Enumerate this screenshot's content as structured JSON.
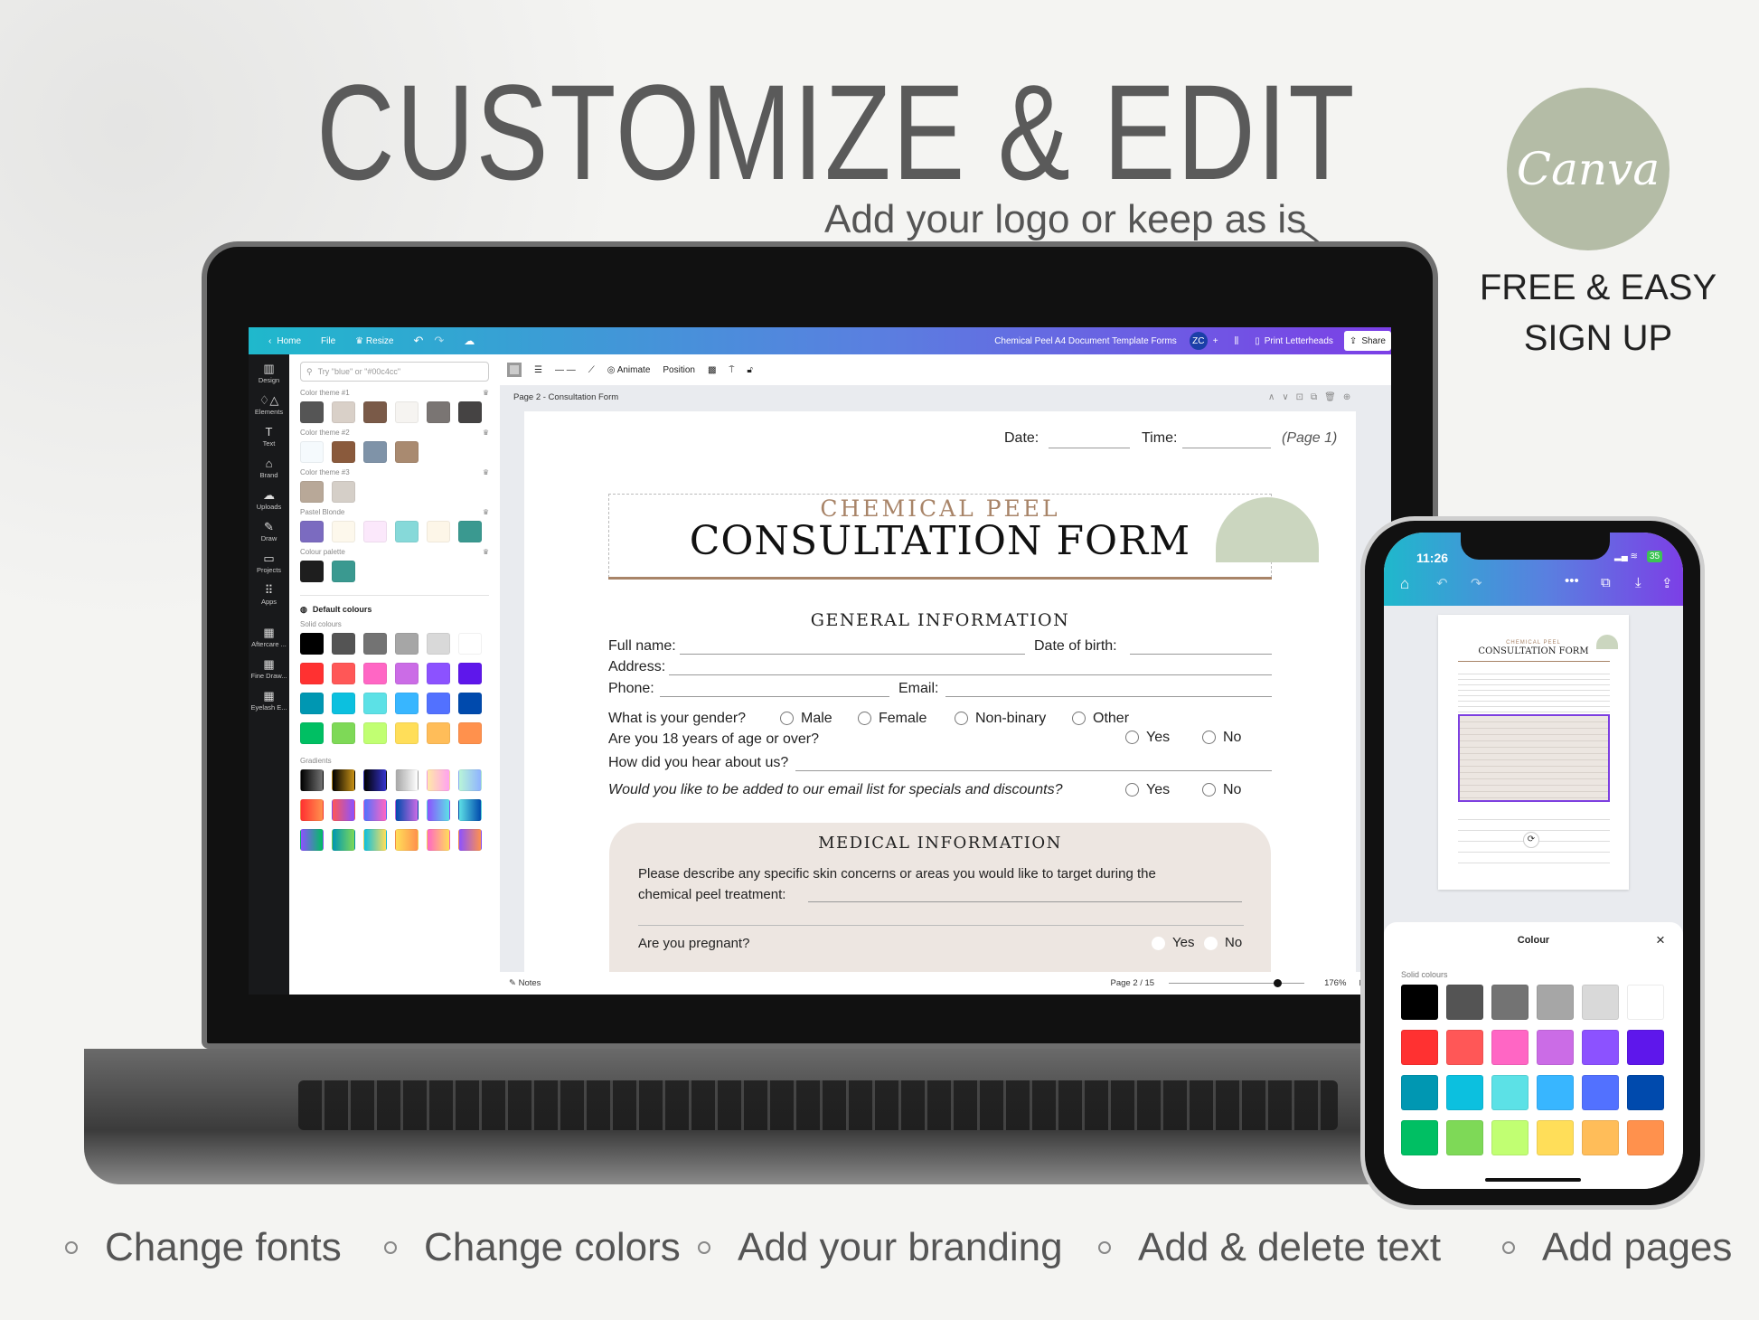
{
  "headline": "CUSTOMIZE & EDIT",
  "subline": "Add your logo or keep as is",
  "brand": {
    "logo_text": "Canva",
    "line1": "FREE & EASY",
    "line2": "SIGN UP",
    "circle_color": "#b4bca6"
  },
  "features": [
    "Change fonts",
    "Change colors",
    "Add your branding",
    "Add & delete text",
    "Add pages"
  ],
  "editor": {
    "topbar": {
      "back_icon": "chevron-left-icon",
      "home": "Home",
      "file": "File",
      "resize": "Resize",
      "doc_title": "Chemical Peel A4 Document Template Forms",
      "avatar": "ZC",
      "print": "Print Letterheads",
      "share": "Share"
    },
    "rail": [
      {
        "label": "Design",
        "icon": "▥"
      },
      {
        "label": "Elements",
        "icon": "♢△"
      },
      {
        "label": "Text",
        "icon": "T"
      },
      {
        "label": "Brand",
        "icon": "⌂"
      },
      {
        "label": "Uploads",
        "icon": "☁"
      },
      {
        "label": "Draw",
        "icon": "✎"
      },
      {
        "label": "Projects",
        "icon": "▭"
      },
      {
        "label": "Apps",
        "icon": "⠿"
      },
      {
        "label": "Aftercare ...",
        "icon": "▦"
      },
      {
        "label": "Fine Draw...",
        "icon": "▦"
      },
      {
        "label": "Eyelash E...",
        "icon": "▦"
      }
    ],
    "panel": {
      "search_placeholder": "Try \"blue\" or \"#00c4cc\"",
      "themes": [
        {
          "title": "Color theme #1",
          "colors": [
            "#555555",
            "#d9d0c8",
            "#7a5a48",
            "#f6f4f1",
            "#7a7573",
            "#454343"
          ]
        },
        {
          "title": "Color theme #2",
          "colors": [
            "#f5fafd",
            "#8a5a3c",
            "#7f93a8",
            "#a98a70"
          ]
        },
        {
          "title": "Color theme #3",
          "colors": [
            "#b8a898",
            "#d5cfc8"
          ]
        },
        {
          "title": "Pastel Blonde",
          "colors": [
            "#7b6bc0",
            "#fdf8ec",
            "#fbe8fb",
            "#86d9d9",
            "#fdf6e8",
            "#3a9990"
          ]
        },
        {
          "title": "Colour palette",
          "colors": [
            "#1e1e1e",
            "#3a9990"
          ]
        }
      ],
      "default_title": "Default colours",
      "solid_title": "Solid colours",
      "solid": [
        "#000000",
        "#545454",
        "#737373",
        "#a6a6a6",
        "#d9d9d9",
        "#ffffff",
        "#ff3131",
        "#ff5757",
        "#ff66c4",
        "#cb6ce6",
        "#8c52ff",
        "#5e17eb",
        "#0097b2",
        "#0cc0df",
        "#5ce1e6",
        "#38b6ff",
        "#5271ff",
        "#004aad",
        "#00bf63",
        "#7ed957",
        "#c1ff72",
        "#ffde59",
        "#ffbd59",
        "#ff914d"
      ],
      "gradients_title": "Gradients",
      "gradients": [
        [
          "#000000",
          "#737373"
        ],
        [
          "#000000",
          "#c89116"
        ],
        [
          "#000000",
          "#3533cd"
        ],
        [
          "#a6a6a6",
          "#ffffff"
        ],
        [
          "#ffe8a8",
          "#ffa2f0"
        ],
        [
          "#b8f5d8",
          "#8fb3ff"
        ],
        [
          "#ff3131",
          "#ff914d"
        ],
        [
          "#ff5757",
          "#8c52ff"
        ],
        [
          "#5170ff",
          "#ff66c4"
        ],
        [
          "#004aad",
          "#cb6ce6"
        ],
        [
          "#8c52ff",
          "#5ce1e6"
        ],
        [
          "#5de0e6",
          "#004aad"
        ],
        [
          "#8c52ff",
          "#00bf63"
        ],
        [
          "#0097b2",
          "#7ed957"
        ],
        [
          "#0cc0df",
          "#ffde59"
        ],
        [
          "#ffde59",
          "#ff914d"
        ],
        [
          "#ff66c4",
          "#ffde59"
        ],
        [
          "#8c52ff",
          "#ff914d"
        ]
      ]
    },
    "toolbar": {
      "animate": "Animate",
      "position": "Position"
    },
    "page_header": "Page 2 - Consultation Form",
    "notes": "Notes",
    "page_indicator": "Page 2 / 15",
    "zoom": "176%",
    "zoom_fraction": 0.8
  },
  "document": {
    "date": "Date:",
    "time": "Time:",
    "page": "(Page 1)",
    "title_small": "CHEMICAL PEEL",
    "title_big": "CONSULTATION FORM",
    "general_heading": "GENERAL INFORMATION",
    "full_name": "Full name:",
    "dob": "Date of birth:",
    "address": "Address:",
    "phone": "Phone:",
    "email": "Email:",
    "gender_q": "What is your gender?",
    "gender_opts": [
      "Male",
      "Female",
      "Non-binary",
      "Other"
    ],
    "age_q": "Are you 18 years of age or over?",
    "hear_q": "How did you hear about us?",
    "email_q": "Would you like to be added to our email list for specials and discounts?",
    "yes": "Yes",
    "no": "No",
    "medical_heading": "MEDICAL INFORMATION",
    "describe_1": "Please describe any specific skin concerns or areas you would like to target during the",
    "describe_2": "chemical peel treatment:",
    "pregnant_q": "Are you pregnant?",
    "accent": "#a88468",
    "panel_bg": "#ede6e1",
    "leaf_color": "#cbd6bf"
  },
  "phone": {
    "time": "11:26",
    "battery": "35",
    "sheet_title": "Colour",
    "solid_title": "Solid colours",
    "close": "×"
  }
}
